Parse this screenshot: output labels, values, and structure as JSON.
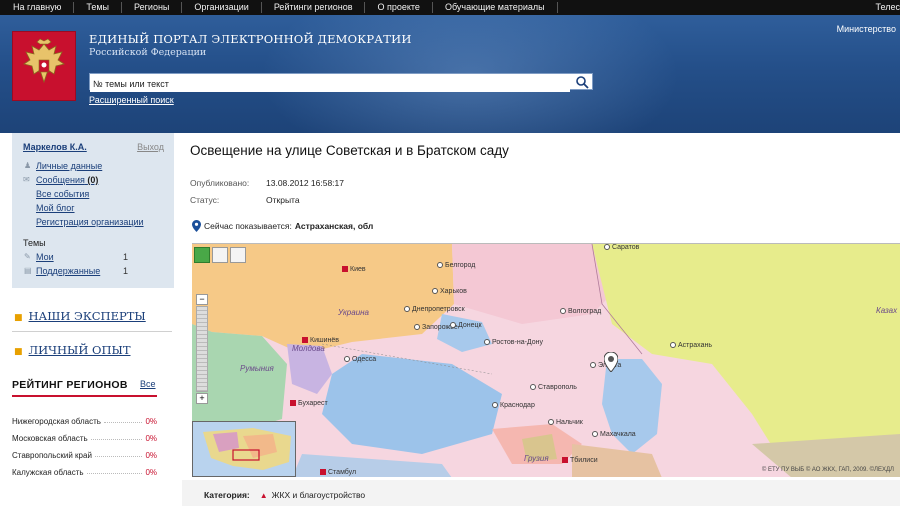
{
  "topnav": {
    "items": [
      "На главную",
      "Темы",
      "Регионы",
      "Организации",
      "Рейтинги регионов",
      "О проекте",
      "Обучающие материалы"
    ],
    "right": "Телес"
  },
  "header": {
    "title": "ЕДИНЫЙ ПОРТАЛ ЭЛЕКТРОННОЙ ДЕМОКРАТИИ",
    "subtitle": "Российской Федерации",
    "ministry": "Министерство",
    "search_value": "№ темы или текст",
    "advanced_search": "Расширенный поиск"
  },
  "sidebar": {
    "user": "Маркелов К.А.",
    "logout": "Выход",
    "links": {
      "personal": "Личные данные",
      "messages": "Сообщения",
      "messages_count": "(0)",
      "all_events": "Все события",
      "blog": "Мой блог",
      "org_reg": "Регистрация организации"
    },
    "topics_heading": "Темы",
    "topics": [
      {
        "label": "Мои",
        "count": "1"
      },
      {
        "label": "Поддержанные",
        "count": "1"
      }
    ],
    "experts": "НАШИ ЭКСПЕРТЫ",
    "experience": "ЛИЧНЫЙ ОПЫТ",
    "rating_heading": "РЕЙТИНГ РЕГИОНОВ",
    "rating_all": "Все",
    "regions": [
      {
        "name": "Нижегородская область",
        "pct": "0%"
      },
      {
        "name": "Московская область",
        "pct": "0%"
      },
      {
        "name": "Ставропольский край",
        "pct": "0%"
      },
      {
        "name": "Калужская область",
        "pct": "0%"
      }
    ]
  },
  "main": {
    "title": "Освещение на улице Советская и в Братском саду",
    "published_label": "Опубликовано:",
    "published_value": "13.08.2012 16:58:17",
    "status_label": "Статус:",
    "status_value": "Открыта",
    "showing_label": "Сейчас показывается:",
    "showing_value": "Астраханская, обл",
    "category_label": "Категория:",
    "category_value": "ЖКХ и благоустройство"
  },
  "map": {
    "cities": [
      "Киев",
      "Белгород",
      "Днепропетровск",
      "Харьков",
      "Запорожье",
      "Донецк",
      "Волгоград",
      "Саратов",
      "Ростов-на-Дону",
      "Одесса",
      "Кишинёв",
      "Краснодар",
      "Ставрополь",
      "Нальчик",
      "Махачкала",
      "Тбилиси",
      "Элиста",
      "Астрахань",
      "Бухарест",
      "Стамбул"
    ],
    "countries": [
      "Украина",
      "Молдова",
      "Румыния",
      "Грузия",
      "Казах"
    ],
    "copyright": "© ЕТУ ПУ ВЫБ © АО ЖКХ, ГАП, 2009. ©ЛЕХДЛ"
  },
  "colors": {
    "header_blue": "#244f89",
    "brand_red": "#c8102e",
    "link_blue": "#1b3f7a",
    "sidebar_box": "#dde6ef"
  }
}
